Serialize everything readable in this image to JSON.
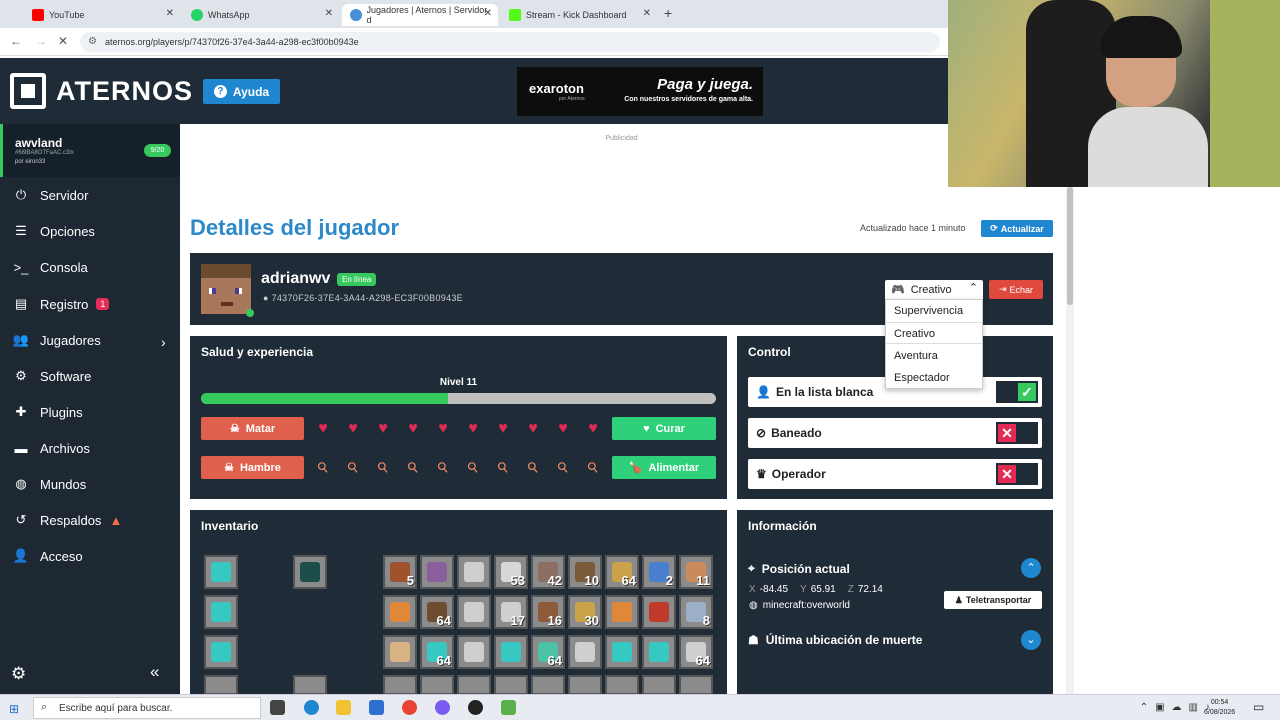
{
  "browser": {
    "tabs": [
      {
        "title": "YouTube",
        "icon_color": "#ff0000"
      },
      {
        "title": "WhatsApp",
        "icon_color": "#25d366"
      },
      {
        "title": "Jugadores | Aternos | Servidor d",
        "icon_color": "#4a90d9"
      },
      {
        "title": "Stream - Kick Dashboard",
        "icon_color": "#53fc18"
      }
    ],
    "new_tab": "+",
    "url": "aternos.org/players/p/74370f26-37e4-3a44-a298-ec3f00b0943e"
  },
  "header": {
    "logo_text": "ATERNOS",
    "help_label": "Ayuda",
    "ad": {
      "brand": "exaroton",
      "brand_sub": "por Aternos",
      "title": "Paga y juega.",
      "subtitle": "Con nuestros servidores de gama alta."
    },
    "ad_label": "Publicidad"
  },
  "sidebar": {
    "server": {
      "name": "awvland",
      "address": "#6i9BA8OTFaAC.c3lx",
      "owner": "por eiron33",
      "players": "9/20"
    },
    "items": [
      {
        "label": "Servidor",
        "icon": "power-icon"
      },
      {
        "label": "Opciones",
        "icon": "sliders-icon"
      },
      {
        "label": "Consola",
        "icon": "terminal-icon"
      },
      {
        "label": "Registro",
        "icon": "file-icon",
        "badge": "1"
      },
      {
        "label": "Jugadores",
        "icon": "users-icon"
      },
      {
        "label": "Software",
        "icon": "gear-icon"
      },
      {
        "label": "Plugins",
        "icon": "puzzle-icon"
      },
      {
        "label": "Archivos",
        "icon": "folder-icon"
      },
      {
        "label": "Mundos",
        "icon": "globe-icon"
      },
      {
        "label": "Respaldos",
        "icon": "backup-icon"
      },
      {
        "label": "Acceso",
        "icon": "user-icon"
      }
    ]
  },
  "page": {
    "title": "Detalles del jugador",
    "updated": "Actualizado hace 1 minuto",
    "refresh_label": "Actualizar"
  },
  "player": {
    "name": "adrianwv",
    "status": "En línea",
    "uuid": "74370F26-37E4-3A44-A298-EC3F00B0943E",
    "gamemode": "Creativo",
    "kick_label": "Echar",
    "gamemode_options": [
      "Supervivencia",
      "Creativo",
      "Aventura",
      "Espectador"
    ]
  },
  "health": {
    "title": "Salud y experiencia",
    "level": "Nivel 11",
    "xp_fraction": 0.48,
    "kill_label": "Matar",
    "heal_label": "Curar",
    "hunger_label": "Hambre",
    "feed_label": "Alimentar",
    "hearts": 10,
    "food": 10
  },
  "control": {
    "title": "Control",
    "whitelist_label": "En la lista blanca",
    "banned_label": "Baneado",
    "operator_label": "Operador",
    "whitelist_on": true,
    "banned_on": false,
    "operator_on": false
  },
  "inventory": {
    "title": "Inventario",
    "counts": [
      "5",
      "",
      "",
      "53",
      "42",
      "10",
      "64",
      "2",
      "11",
      "",
      "64",
      "",
      "17",
      "16",
      "30",
      "",
      "",
      "8",
      "",
      "64",
      "",
      "",
      "64",
      "",
      "",
      "",
      "64"
    ]
  },
  "info": {
    "title": "Información",
    "position_label": "Posición actual",
    "x": "-84.45",
    "y": "65.91",
    "z": "72.14",
    "dimension": "minecraft:overworld",
    "teleport_label": "Teletransportar",
    "death_label": "Última ubicación de muerte"
  },
  "taskbar": {
    "search_placeholder": "Escribe aquí para buscar.",
    "time": "00:54",
    "date": "6/08/2026"
  }
}
